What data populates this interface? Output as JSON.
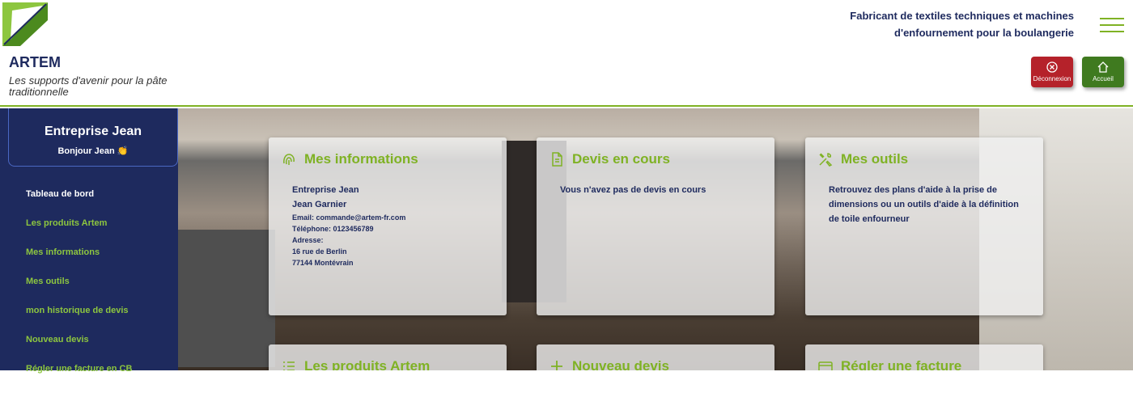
{
  "header": {
    "brand_name": "ARTEM",
    "tagline": "Les supports d'avenir pour la pâte traditionnelle",
    "headline_line1": "Fabricant de textiles techniques et machines",
    "headline_line2": "d'enfournement pour la boulangerie",
    "logout_label": "Déconnexion",
    "home_label": "Accueil"
  },
  "sidebar": {
    "company": "Entreprise Jean",
    "greeting": "Bonjour Jean 👏",
    "items": [
      {
        "label": "Tableau de bord"
      },
      {
        "label": "Les produits Artem"
      },
      {
        "label": "Mes informations"
      },
      {
        "label": "Mes outils"
      },
      {
        "label": "mon historique de devis"
      },
      {
        "label": "Nouveau devis"
      },
      {
        "label": "Régler une facture en CB"
      }
    ]
  },
  "cards": {
    "infos": {
      "title": "Mes informations",
      "company": "Entreprise Jean",
      "person": "Jean Garnier",
      "email": "Email: commande@artem-fr.com",
      "phone": "Téléphone: 0123456789",
      "address_label": "Adresse:",
      "street": "16 rue de Berlin",
      "city": "77144 Montévrain"
    },
    "devis": {
      "title": "Devis en cours",
      "text": "Vous n'avez pas de devis en cours"
    },
    "outils": {
      "title": "Mes outils",
      "line1": "Retrouvez des plans d'aide à la prise de",
      "line2": "dimensions ou un outils d'aide à la définition",
      "line3": "de toile enfourneur"
    },
    "produits": {
      "title": "Les produits Artem"
    },
    "nouveau": {
      "title": "Nouveau devis"
    },
    "facture": {
      "title": "Régler une facture"
    }
  },
  "colors": {
    "accent_green": "#7fb224",
    "navy": "#1e2a5e",
    "logout_red": "#b5222a",
    "home_green": "#3f7a1f"
  }
}
